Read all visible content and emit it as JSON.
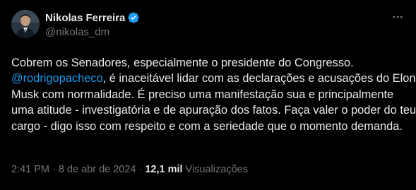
{
  "author": {
    "display_name": "Nikolas Ferreira",
    "handle": "@nikolas_dm",
    "verified": true,
    "avatar": "profile-photo"
  },
  "tweet": {
    "text_before": "Cobrem os Senadores, especialmente o presidente do Congresso.",
    "mention": "@rodrigopacheco",
    "text_after": ", é inaceitável lidar com as declarações e acusações do Elon Musk com normalidade. É preciso uma manifestação sua e principalmente uma atitude - investigatória e de apuração dos fatos. Faça valer o poder do teu cargo - digo isso com respeito e com a seriedade que o momento demanda."
  },
  "meta": {
    "time": "2:41 PM",
    "date": "8 de abr de 2024",
    "separator": "·",
    "views_count": "12,1 mil",
    "views_label": "Visualizações"
  },
  "icons": {
    "verified": "verified-badge-icon",
    "more": "more-options-icon"
  },
  "colors": {
    "background": "#000000",
    "text": "#e7e9ea",
    "secondary": "#71767b",
    "accent": "#1d9bf0"
  }
}
